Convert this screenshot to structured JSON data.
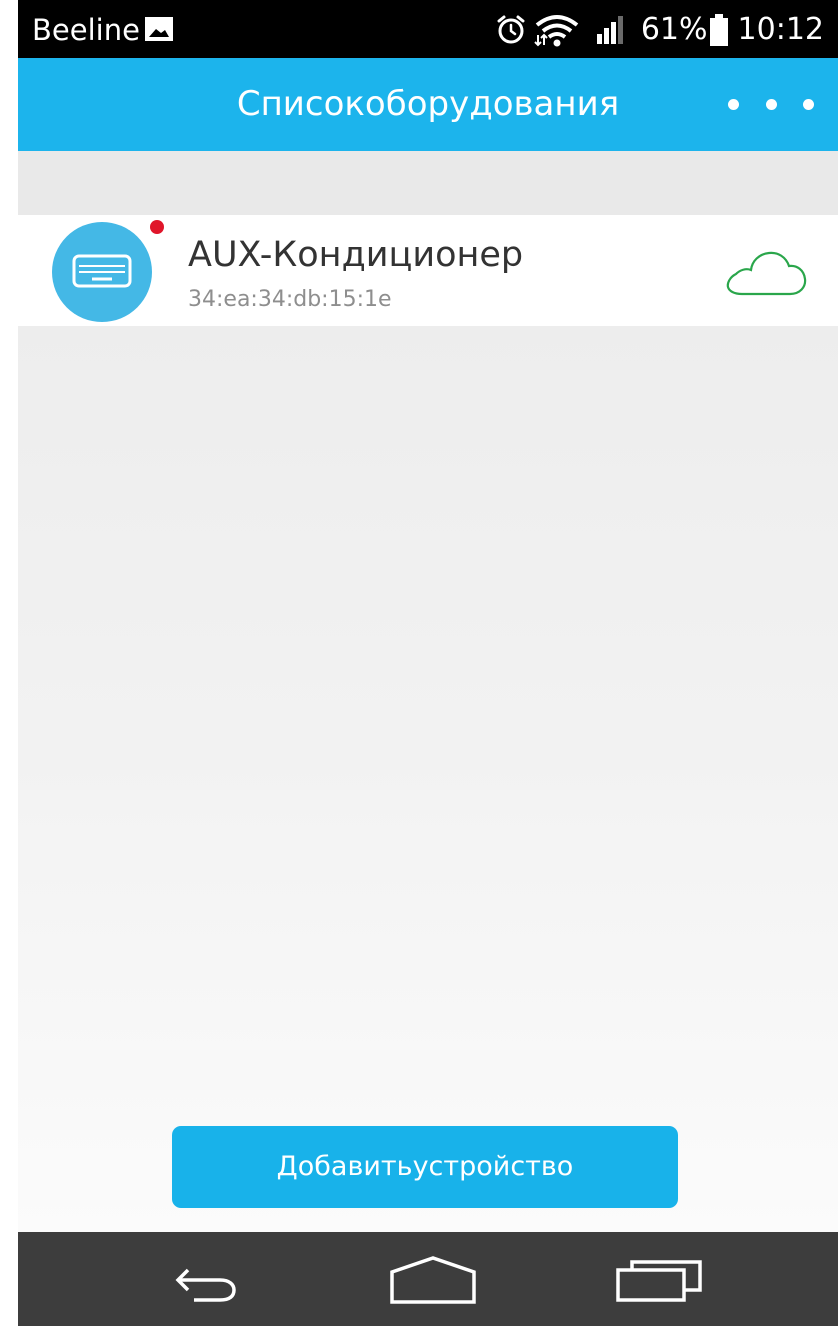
{
  "status_bar": {
    "carrier": "Beeline",
    "battery_percent": "61%",
    "time": "10:12",
    "icons": [
      "gallery-icon",
      "alarm-icon",
      "wifi-icon",
      "signal-icon",
      "battery-icon"
    ]
  },
  "header": {
    "title": "Списокоборудования",
    "menu_icon": "more-dots-icon"
  },
  "devices": [
    {
      "name": "AUX-Кондиционер",
      "mac": "34:ea:34:db:15:1e",
      "icon": "air-conditioner-icon",
      "has_notification": true,
      "connection_icon": "cloud-icon"
    }
  ],
  "add_device_button": {
    "label": "Добавитьустройство"
  },
  "nav_bar": {
    "icons": [
      "back-icon",
      "home-icon",
      "recents-icon"
    ]
  },
  "colors": {
    "accent": "#1cb4ec",
    "notification": "#e0152a",
    "cloud_online": "#2aa64b",
    "nav_bar": "#3d3d3d"
  }
}
